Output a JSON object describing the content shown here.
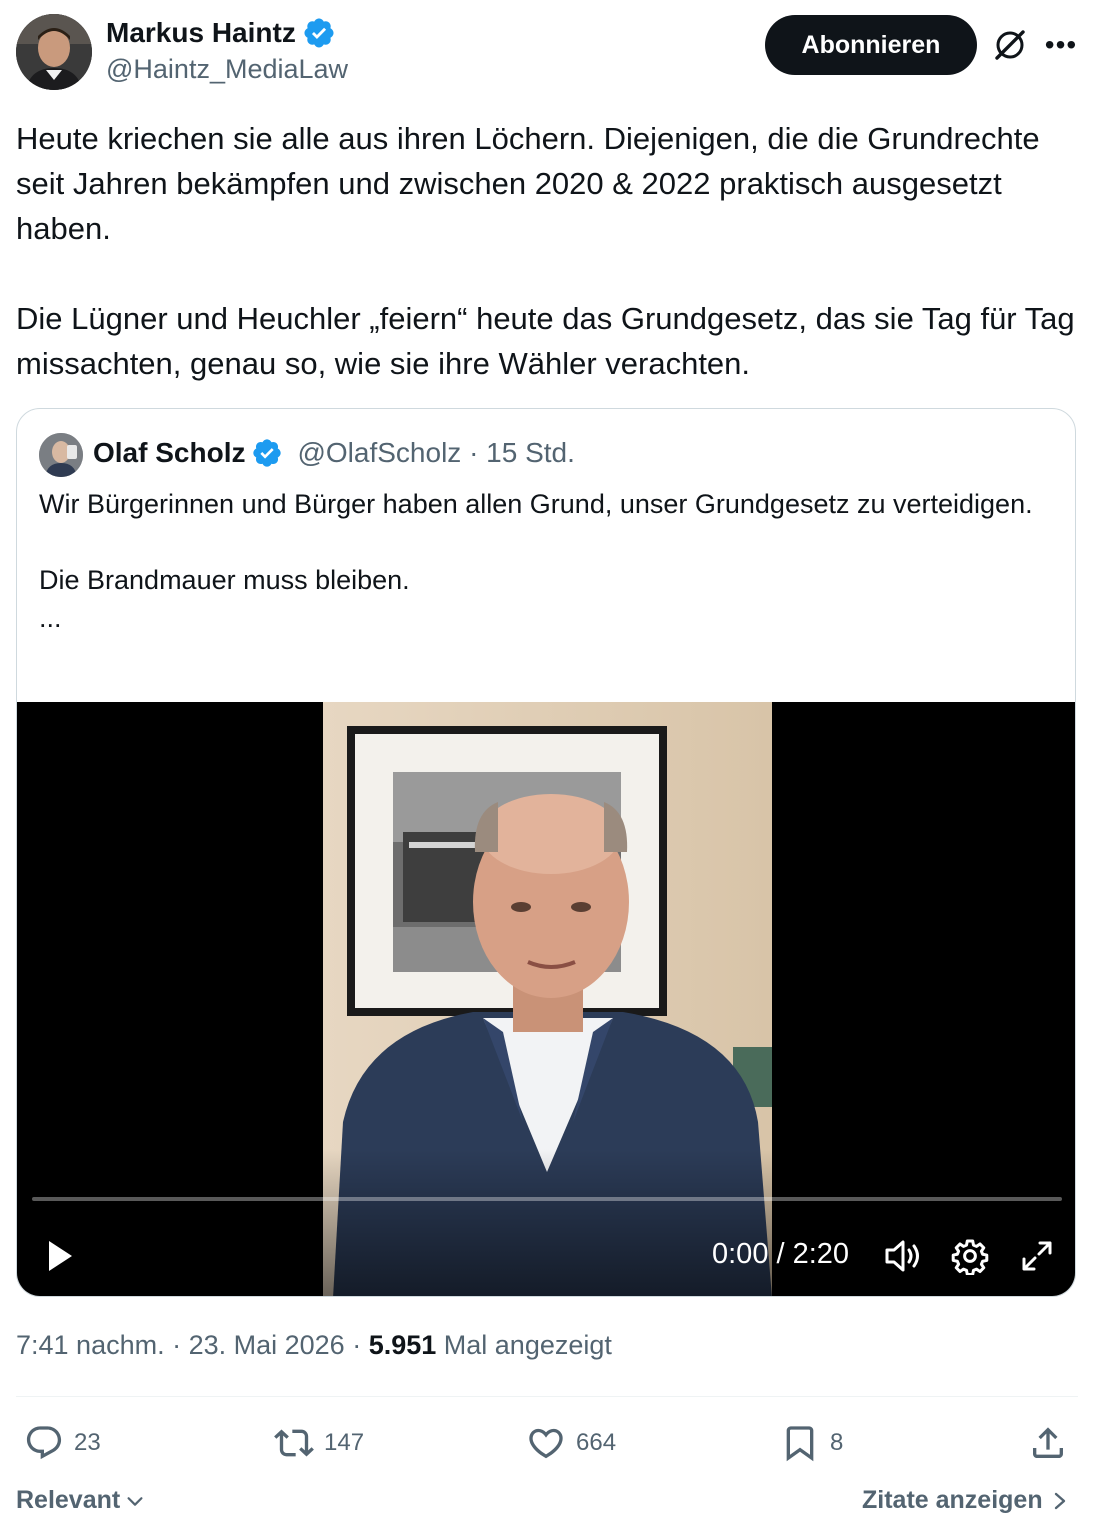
{
  "author": {
    "name": "Markus Haintz",
    "handle": "@Haintz_MediaLaw",
    "verified": true
  },
  "follow_label": "Abonnieren",
  "tweet_text": "Heute kriechen sie alle aus ihren Löchern. Diejenigen, die die Grundrechte seit Jahren bekämpfen und zwischen 2020 & 2022 praktisch ausgesetzt haben.\n\nDie Lügner und Heuchler „feiern“ heute das Grundgesetz, das sie Tag für Tag missachten, genau so, wie sie ihre Wähler verachten.",
  "quoted": {
    "name": "Olaf Scholz",
    "handle_time": "@OlafScholz · 15 Std.",
    "text": "Wir Bürgerinnen und Bürger haben allen Grund, unser Grundgesetz zu verteidigen.\n\nDie Brandmauer muss bleiben.\n...",
    "video": {
      "time": "0:00 / 2:20",
      "progress": 0.0
    }
  },
  "meta": {
    "time": "7:41 nachm.",
    "sep1": " · ",
    "date": "23. Mai 2026",
    "sep2": " · ",
    "views": "5.951",
    "views_label": " Mal angezeigt"
  },
  "actions": {
    "replies": "23",
    "retweets": "147",
    "likes": "664",
    "bookmarks": "8"
  },
  "footer": {
    "sort_label": "Relevant",
    "quotes_label": "Zitate anzeigen"
  },
  "colors": {
    "verified": "#1d9bf0",
    "text": "#0f1419",
    "secondary": "#536471",
    "border": "#cfd9de"
  }
}
